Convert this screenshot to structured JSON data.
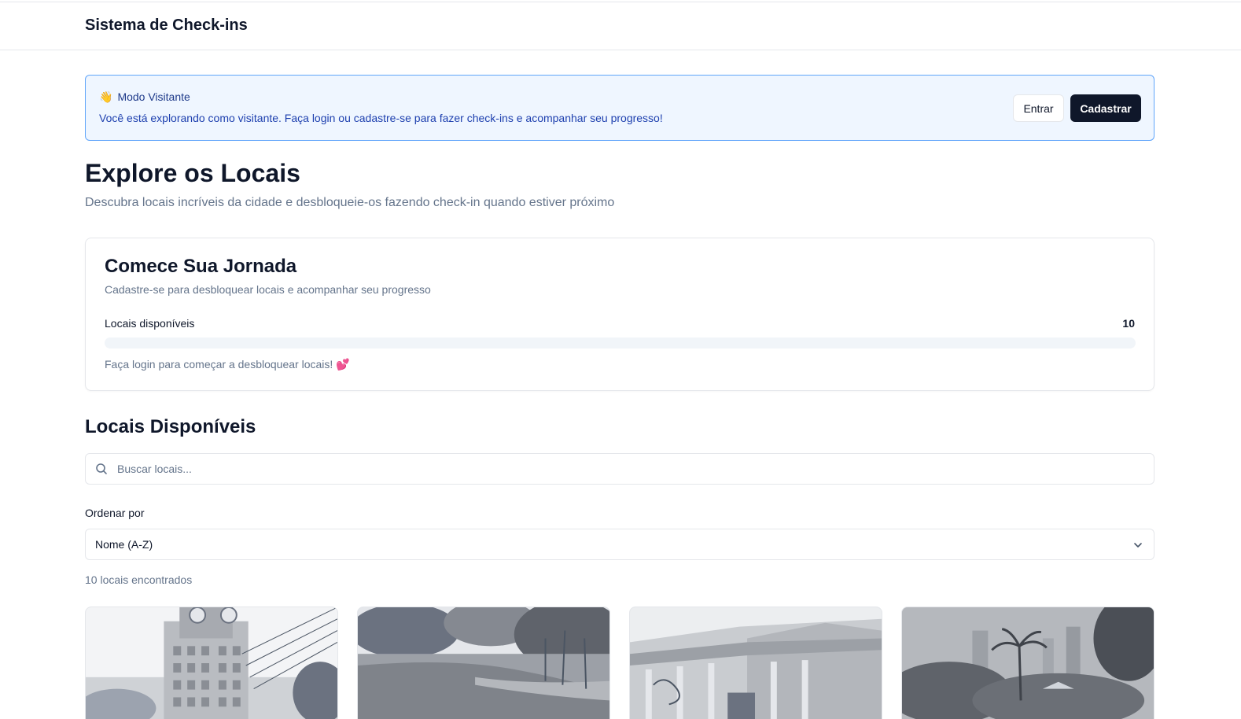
{
  "header": {
    "title": "Sistema de Check-ins"
  },
  "banner": {
    "icon": "waving-hand-icon",
    "title": "Modo Visitante",
    "text": "Você está explorando como visitante. Faça login ou cadastre-se para fazer check-ins e acompanhar seu progresso!",
    "login_label": "Entrar",
    "signup_label": "Cadastrar"
  },
  "main": {
    "title": "Explore os Locais",
    "subtitle": "Descubra locais incríveis da cidade e desbloqueie-os fazendo check-in quando estiver próximo"
  },
  "journey": {
    "title": "Comece Sua Jornada",
    "description": "Cadastre-se para desbloquear locais e acompanhar seu progresso",
    "progress_label": "Locais disponíveis",
    "progress_count": "10",
    "progress_fraction": 0,
    "hint": "Faça login para começar a desbloquear locais! 💕"
  },
  "places": {
    "title": "Locais Disponíveis",
    "search_placeholder": "Buscar locais...",
    "sort_label": "Ordenar por",
    "sort_value": "Nome (A-Z)",
    "results_text": "10 locais encontrados",
    "cards": [
      {
        "image": "clock-tower-photo"
      },
      {
        "image": "lake-park-photo"
      },
      {
        "image": "building-photo"
      },
      {
        "image": "palm-trees-photo"
      }
    ]
  },
  "colors": {
    "primary": "#0f172a",
    "banner_bg": "#eff6ff",
    "banner_border": "#60a5fa",
    "muted_text": "#64748b"
  }
}
